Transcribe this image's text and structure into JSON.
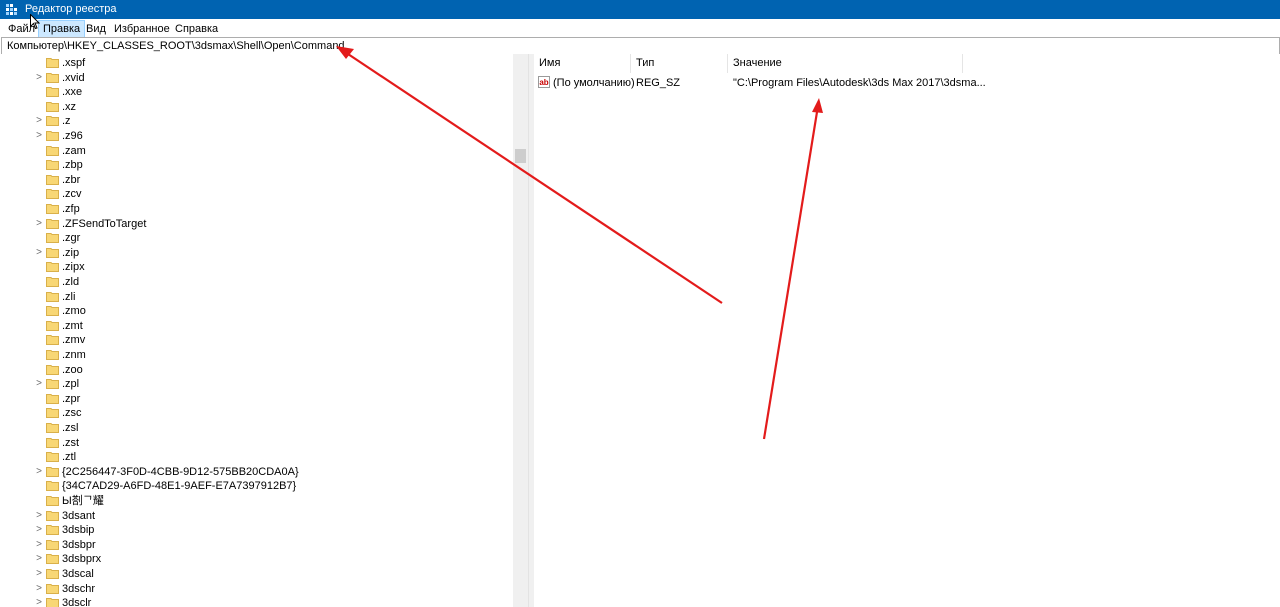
{
  "window": {
    "title": "Редактор реестра",
    "icon": "regedit-icon",
    "title_color": "#0063b1"
  },
  "menu": {
    "file": "Файл",
    "edit": "Правка",
    "view": "Вид",
    "favorites": "Избранное",
    "help": "Справка"
  },
  "address": {
    "path": "Компьютер\\HKEY_CLASSES_ROOT\\3dsmax\\Shell\\Open\\Command"
  },
  "tree": {
    "items": [
      {
        "label": ".xspf",
        "expandable": false
      },
      {
        "label": ".xvid",
        "expandable": true
      },
      {
        "label": ".xxe",
        "expandable": false
      },
      {
        "label": ".xz",
        "expandable": false
      },
      {
        "label": ".z",
        "expandable": true
      },
      {
        "label": ".z96",
        "expandable": true
      },
      {
        "label": ".zam",
        "expandable": false
      },
      {
        "label": ".zbp",
        "expandable": false
      },
      {
        "label": ".zbr",
        "expandable": false
      },
      {
        "label": ".zcv",
        "expandable": false
      },
      {
        "label": ".zfp",
        "expandable": false
      },
      {
        "label": ".ZFSendToTarget",
        "expandable": true
      },
      {
        "label": ".zgr",
        "expandable": false
      },
      {
        "label": ".zip",
        "expandable": true
      },
      {
        "label": ".zipx",
        "expandable": false
      },
      {
        "label": ".zld",
        "expandable": false
      },
      {
        "label": ".zli",
        "expandable": false
      },
      {
        "label": ".zmo",
        "expandable": false
      },
      {
        "label": ".zmt",
        "expandable": false
      },
      {
        "label": ".zmv",
        "expandable": false
      },
      {
        "label": ".znm",
        "expandable": false
      },
      {
        "label": ".zoo",
        "expandable": false
      },
      {
        "label": ".zpl",
        "expandable": true
      },
      {
        "label": ".zpr",
        "expandable": false
      },
      {
        "label": ".zsc",
        "expandable": false
      },
      {
        "label": ".zsl",
        "expandable": false
      },
      {
        "label": ".zst",
        "expandable": false
      },
      {
        "label": ".ztl",
        "expandable": false
      },
      {
        "label": "{2C256447-3F0D-4CBB-9D12-575BB20CDA0A}",
        "expandable": true
      },
      {
        "label": "{34C7AD29-A6FD-48E1-9AEF-E7A7397912B7}",
        "expandable": false
      },
      {
        "label": "Ы剳ᄀ耀",
        "expandable": false
      },
      {
        "label": "3dsant",
        "expandable": true
      },
      {
        "label": "3dsbip",
        "expandable": true
      },
      {
        "label": "3dsbpr",
        "expandable": true
      },
      {
        "label": "3dsbprx",
        "expandable": true
      },
      {
        "label": "3dscal",
        "expandable": true
      },
      {
        "label": "3dschr",
        "expandable": true
      },
      {
        "label": "3dsclr",
        "expandable": true
      }
    ]
  },
  "values_panel": {
    "columns": {
      "name": "Имя",
      "type": "Тип",
      "value": "Значение"
    },
    "rows": [
      {
        "name": "(По умолчанию)",
        "type": "REG_SZ",
        "value": "\"C:\\Program Files\\Autodesk\\3ds Max 2017\\3dsma...",
        "icon": "string-value-icon"
      }
    ]
  },
  "annotations": {
    "arrow_color": "#e31b1b"
  }
}
